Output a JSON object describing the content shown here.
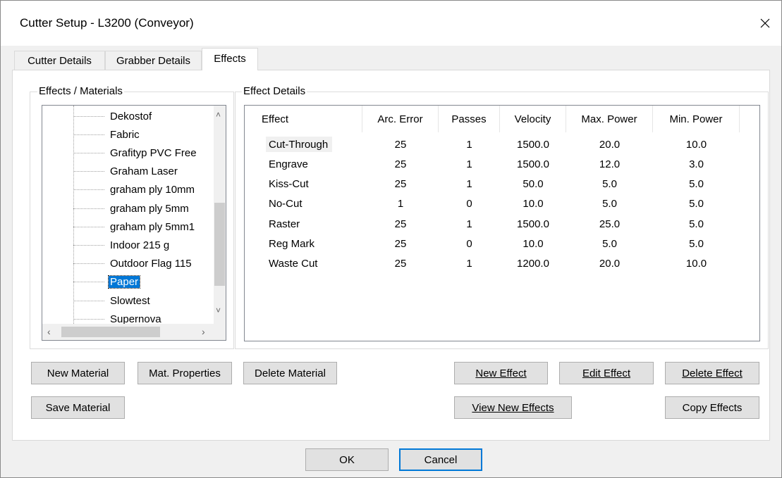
{
  "window": {
    "title": "Cutter Setup - L3200 (Conveyor)"
  },
  "tabs": [
    {
      "label": "Cutter Details"
    },
    {
      "label": "Grabber Details"
    },
    {
      "label": "Effects"
    }
  ],
  "materials": {
    "group_label": "Effects / Materials",
    "items": [
      "Dekostof",
      "Fabric",
      "Grafityp PVC Free",
      "Graham Laser",
      "graham ply 10mm",
      "graham ply 5mm",
      "graham ply 5mm1",
      "Indoor 215 g",
      "Outdoor Flag 115",
      "Paper",
      "Slowtest",
      "Supernova"
    ],
    "selected": "Paper"
  },
  "effects": {
    "group_label": "Effect Details",
    "columns": [
      "Effect",
      "Arc. Error",
      "Passes",
      "Velocity",
      "Max. Power",
      "Min. Power"
    ],
    "rows": [
      [
        "Cut-Through",
        "25",
        "1",
        "1500.0",
        "20.0",
        "10.0"
      ],
      [
        "Engrave",
        "25",
        "1",
        "1500.0",
        "12.0",
        "3.0"
      ],
      [
        "Kiss-Cut",
        "25",
        "1",
        "50.0",
        "5.0",
        "5.0"
      ],
      [
        "No-Cut",
        "1",
        "0",
        "10.0",
        "5.0",
        "5.0"
      ],
      [
        "Raster",
        "25",
        "1",
        "1500.0",
        "25.0",
        "5.0"
      ],
      [
        "Reg Mark",
        "25",
        "0",
        "10.0",
        "5.0",
        "5.0"
      ],
      [
        "Waste Cut",
        "25",
        "1",
        "1200.0",
        "20.0",
        "10.0"
      ]
    ]
  },
  "buttons": {
    "new_material": "New Material",
    "mat_properties": "Mat. Properties",
    "delete_material": "Delete Material",
    "save_material": "Save Material",
    "new_effect": "New Effect",
    "edit_effect": "Edit Effect",
    "delete_effect": "Delete Effect",
    "view_new_effects": "View New Effects",
    "copy_effects": "Copy Effects",
    "ok": "OK",
    "cancel": "Cancel"
  },
  "icons": {
    "close": "close-icon",
    "scroll_up": "chevron-up-icon",
    "scroll_down": "chevron-down-icon",
    "scroll_left": "chevron-left-icon",
    "scroll_right": "chevron-right-icon"
  },
  "colors": {
    "selection": "#0078d7",
    "default_button_border": "#0078d7"
  }
}
